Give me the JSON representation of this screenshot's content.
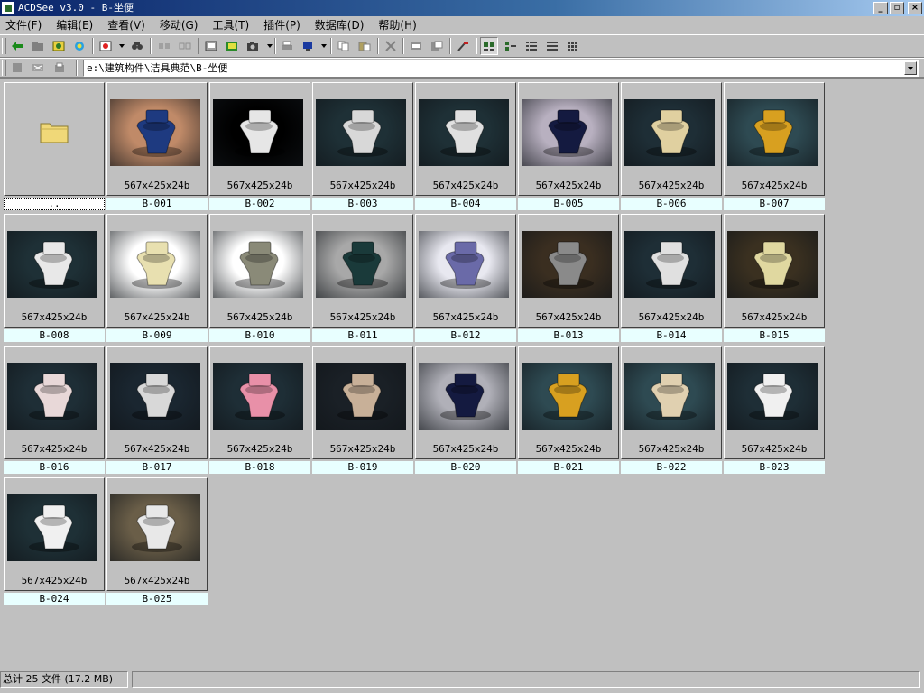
{
  "window": {
    "title": "ACDSee v3.0 - B-坐便",
    "controls": {
      "minimize": "_",
      "maximize": "▫",
      "close": "×"
    }
  },
  "menu": [
    {
      "label": "文件(F)"
    },
    {
      "label": "编辑(E)"
    },
    {
      "label": "查看(V)"
    },
    {
      "label": "移动(G)"
    },
    {
      "label": "工具(T)"
    },
    {
      "label": "插件(P)"
    },
    {
      "label": "数据库(D)"
    },
    {
      "label": "帮助(H)"
    }
  ],
  "address": {
    "path": "e:\\建筑构件\\洁具典范\\B-坐便"
  },
  "parent_folder": {
    "name": ".."
  },
  "thumbnails": [
    {
      "name": "B-001",
      "info": "567x425x24b",
      "bg": "#c08a68",
      "color": "#1e3a80"
    },
    {
      "name": "B-002",
      "info": "567x425x24b",
      "bg": "#000000",
      "color": "#e6e6e6"
    },
    {
      "name": "B-003",
      "info": "567x425x24b",
      "bg": "#1e3036",
      "color": "#d8d8d8"
    },
    {
      "name": "B-004",
      "info": "567x425x24b",
      "bg": "#1e3036",
      "color": "#e0e0e0"
    },
    {
      "name": "B-005",
      "info": "567x425x24b",
      "bg": "#b8b0c0",
      "color": "#141a40"
    },
    {
      "name": "B-006",
      "info": "567x425x24b",
      "bg": "#1e2e36",
      "color": "#e0d0a0"
    },
    {
      "name": "B-007",
      "info": "567x425x24b",
      "bg": "#2e4a52",
      "color": "#d8a020"
    },
    {
      "name": "B-008",
      "info": "567x425x24b",
      "bg": "#1e3036",
      "color": "#e8e8e8"
    },
    {
      "name": "B-009",
      "info": "567x425x24b",
      "bg": "#ffffff",
      "color": "#e8e0b0"
    },
    {
      "name": "B-010",
      "info": "567x425x24b",
      "bg": "#ffffff",
      "color": "#8a8a78"
    },
    {
      "name": "B-011",
      "info": "567x425x24b",
      "bg": "#a8a8a8",
      "color": "#1a3a3a"
    },
    {
      "name": "B-012",
      "info": "567x425x24b",
      "bg": "#e8e8f0",
      "color": "#6a6aa8"
    },
    {
      "name": "B-013",
      "info": "567x425x24b",
      "bg": "#3a2e20",
      "color": "#8a8a8a"
    },
    {
      "name": "B-014",
      "info": "567x425x24b",
      "bg": "#1e2e36",
      "color": "#e0e0e0"
    },
    {
      "name": "B-015",
      "info": "567x425x24b",
      "bg": "#3a3020",
      "color": "#e0d8a0"
    },
    {
      "name": "B-016",
      "info": "567x425x24b",
      "bg": "#1e2e36",
      "color": "#e8d8d8"
    },
    {
      "name": "B-017",
      "info": "567x425x24b",
      "bg": "#1a2630",
      "color": "#d8d8d8"
    },
    {
      "name": "B-018",
      "info": "567x425x24b",
      "bg": "#1e2e36",
      "color": "#e890a8"
    },
    {
      "name": "B-019",
      "info": "567x425x24b",
      "bg": "#1a2026",
      "color": "#c8b098"
    },
    {
      "name": "B-020",
      "info": "567x425x24b",
      "bg": "#b0b0b8",
      "color": "#141a40"
    },
    {
      "name": "B-021",
      "info": "567x425x24b",
      "bg": "#2e4a52",
      "color": "#d8a020"
    },
    {
      "name": "B-022",
      "info": "567x425x24b",
      "bg": "#2e4a52",
      "color": "#e0d0b0"
    },
    {
      "name": "B-023",
      "info": "567x425x24b",
      "bg": "#1e2e36",
      "color": "#f0f0f0"
    },
    {
      "name": "B-024",
      "info": "567x425x24b",
      "bg": "#1e3036",
      "color": "#f0f0f0"
    },
    {
      "name": "B-025",
      "info": "567x425x24b",
      "bg": "#6a5e48",
      "color": "#e8e8e8"
    }
  ],
  "status": {
    "summary": "总计 25 文件 (17.2 MB)",
    "detail": ""
  },
  "toolbar_icons": [
    "back-icon",
    "browse-icon",
    "view-icon",
    "refresh-icon",
    "favorites-icon",
    "find-icon",
    "copy-to-icon",
    "move-to-icon",
    "acquire-icon",
    "slideshow-icon",
    "camera-icon",
    "print-icon",
    "wallpaper-icon",
    "copy-icon",
    "paste-icon",
    "delete-icon",
    "rename-icon",
    "properties-icon",
    "tools-icon",
    "large-icons-icon",
    "small-icons-icon",
    "list-icon",
    "details-icon",
    "thumbnails-icon"
  ]
}
